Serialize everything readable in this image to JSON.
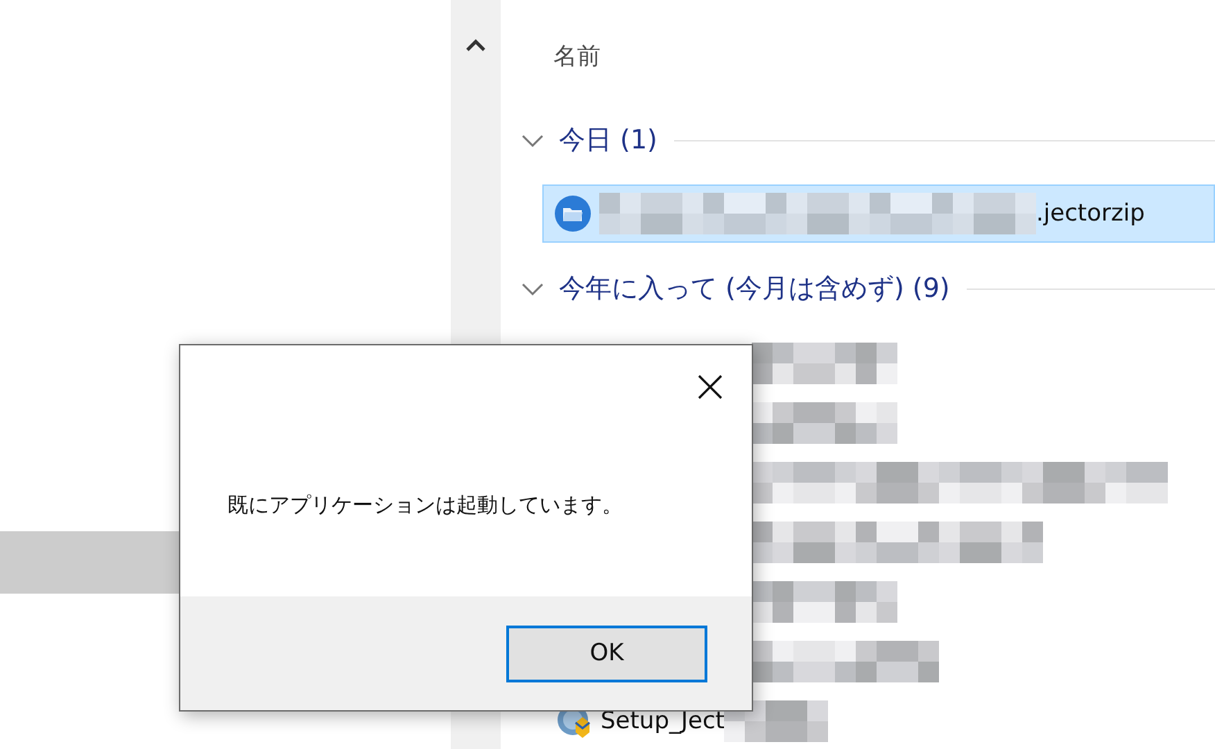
{
  "file_list": {
    "column_header": "名前",
    "groups": [
      {
        "label": "今日 (1)",
        "expanded": true,
        "files": [
          {
            "name": ".jectorzip",
            "selected": true,
            "blurred": true
          }
        ]
      },
      {
        "label": "今年に入って (今月は含めず) (9)",
        "expanded": true,
        "files": [
          {
            "blurred": true,
            "selected": false
          },
          {
            "blurred": true,
            "selected": false
          },
          {
            "blurred": true,
            "selected": false
          },
          {
            "blurred": true,
            "selected": false
          },
          {
            "blurred": true,
            "selected": false
          },
          {
            "blurred": true,
            "selected": false
          },
          {
            "name": "Setup_Ject",
            "blurred": true,
            "selected": false
          }
        ]
      }
    ]
  },
  "dialog": {
    "message": "既にアプリケーションは起動しています。",
    "button": "OK",
    "button_focused": true
  }
}
